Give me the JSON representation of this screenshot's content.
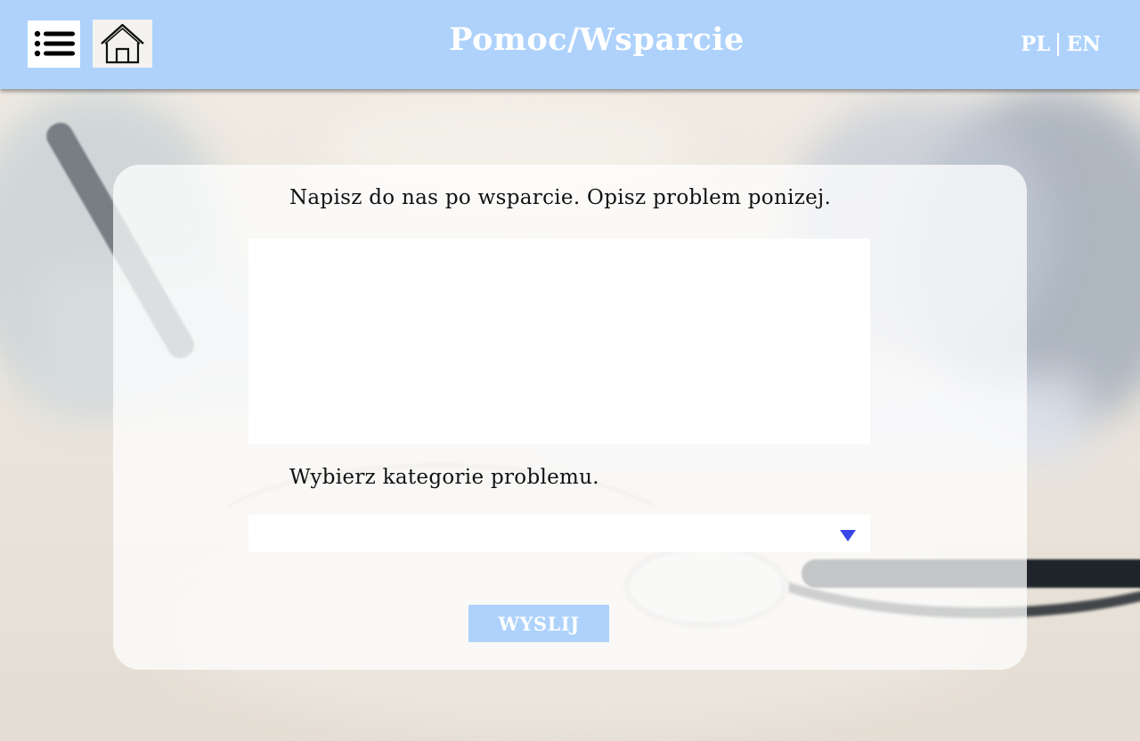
{
  "header": {
    "title": "Pomoc/Wsparcie",
    "menu_icon": "menu-list-icon",
    "home_icon": "home-icon",
    "languages": [
      "PL",
      "EN"
    ]
  },
  "form": {
    "description_label": "Napisz do nas po wsparcie. Opisz problem ponizej.",
    "description_value": "",
    "category_label": "Wybierz kategorie problemu.",
    "category_selected": "",
    "dropdown_icon": "triangle-down-icon",
    "submit_label": "WYSLIJ"
  },
  "colors": {
    "header_bg": "#aed2fb",
    "button_bg": "#aed2fb",
    "dropdown_arrow": "#3b46e6",
    "card_bg": "#ffffffbd"
  }
}
